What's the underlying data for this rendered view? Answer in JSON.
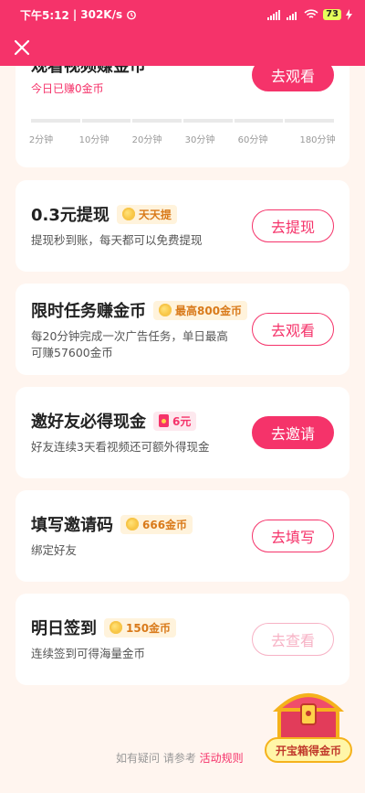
{
  "status_bar": {
    "time": "下午5:12",
    "network_speed": "302K/s",
    "battery": "73"
  },
  "watch_card": {
    "title_partial": "观看视频赚金币",
    "subtitle": "今日已赚0金币",
    "button": "去观看",
    "ticks": [
      "2分钟",
      "10分钟",
      "20分钟",
      "30分钟",
      "60分钟",
      "180分钟"
    ],
    "progress": 0
  },
  "tasks": [
    {
      "title": "0.3元提现",
      "tag": "天天提",
      "tag_icon": "coin-icon",
      "desc_line1": "提现秒到账，每天都可以免费提现",
      "desc_line2": "",
      "button": "去提现",
      "style": "outline"
    },
    {
      "title": "限时任务赚金币",
      "tag": "最高800金币",
      "tag_icon": "coin-icon",
      "desc_line1": "每20分钟完成一次广告任务，单日最高",
      "desc_line2": "可赚57600金币",
      "button": "去观看",
      "style": "outline"
    },
    {
      "title": "邀好友必得现金",
      "tag": "6元",
      "tag_icon": "red-envelope-icon",
      "desc_line1": "好友连续3天看视频还可额外得现金",
      "desc_line2": "",
      "button": "去邀请",
      "style": "filled"
    },
    {
      "title": "填写邀请码",
      "tag": "666金币",
      "tag_icon": "coin-icon",
      "desc_line1": "绑定好友",
      "desc_line2": "",
      "button": "去填写",
      "style": "outline"
    },
    {
      "title": "明日签到",
      "tag": "150金币",
      "tag_icon": "coin-icon",
      "desc_line1": "连续签到可得海量金币",
      "desc_line2": "",
      "button": "去查看",
      "style": "disabled"
    }
  ],
  "footer": {
    "text": "如有疑问 请参考",
    "link": "活动规则"
  },
  "treasure": {
    "label": "开宝箱得金币"
  },
  "colors": {
    "accent": "#f5336a",
    "background": "#fff5ef",
    "coin": "#f5b21c"
  }
}
